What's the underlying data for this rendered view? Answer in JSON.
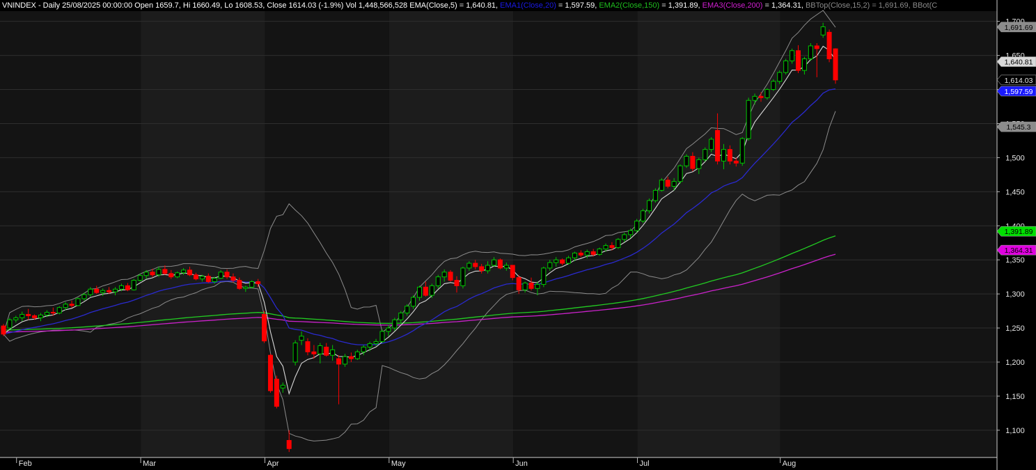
{
  "header": [
    {
      "text": "VNINDEX - Daily 25/08/2025 00:00:00 Open 1659.7, Hi 1660.49, Lo 1608.53, Close 1614.03 (-1.9%) Vol 1,448,566,528 ",
      "color": "#ffffff"
    },
    {
      "text": "EMA(Close,5) = 1,640.81, ",
      "color": "#ffffff"
    },
    {
      "text": "EMA1(Close,20)",
      "color": "#1a1ae6"
    },
    {
      "text": " = 1,597.59, ",
      "color": "#ffffff"
    },
    {
      "text": "EMA2(Close,150)",
      "color": "#1fbf1f"
    },
    {
      "text": " = 1,391.89, ",
      "color": "#ffffff"
    },
    {
      "text": "EMA3(Close,200)",
      "color": "#d01fd0"
    },
    {
      "text": " = 1,364.31, ",
      "color": "#ffffff"
    },
    {
      "text": "BBTop(Close,15,2) = 1,691.69, BBot(C",
      "color": "#8a8a8a"
    }
  ],
  "colors": {
    "up": "#00c800",
    "down": "#ff0000",
    "ema5": "#d8d8d8",
    "ema20": "#2a2ad0",
    "ema150": "#22cc22",
    "ema200": "#cc22cc",
    "bb": "#8c8c8c",
    "grid": "#2a2a2a"
  },
  "chart_data": {
    "type": "candlestick",
    "symbol": "VNINDEX",
    "ylim": [
      1060,
      1715
    ],
    "y_ticks": [
      "1,100",
      "1,150",
      "1,200",
      "1,250",
      "1,300",
      "1,350",
      "1,400",
      "1,450",
      "1,500",
      "1,550",
      "1,600",
      "1,650",
      "1,700"
    ],
    "x_months": [
      {
        "label": "Feb",
        "index": 3
      },
      {
        "label": "Mar",
        "index": 23
      },
      {
        "label": "Apr",
        "index": 43
      },
      {
        "label": "May",
        "index": 63
      },
      {
        "label": "Jun",
        "index": 83
      },
      {
        "label": "Jul",
        "index": 103
      },
      {
        "label": "Aug",
        "index": 126
      }
    ],
    "value_tags": [
      {
        "label": "1,691.69",
        "value": 1691.69,
        "bg": "#8c8c8c",
        "fg": "#000000"
      },
      {
        "label": "1,640.81",
        "value": 1640.81,
        "bg": "#d8d8d8",
        "fg": "#000000"
      },
      {
        "label": "1,614.03",
        "value": 1614.03,
        "bg": "#000000",
        "fg": "#e6e6e6"
      },
      {
        "label": "1,597.59",
        "value": 1597.59,
        "bg": "#1a1aff",
        "fg": "#ffffff"
      },
      {
        "label": "1,545.3",
        "value": 1545.3,
        "bg": "#8c8c8c",
        "fg": "#000000"
      },
      {
        "label": "1,391.89",
        "value": 1391.89,
        "bg": "#00e000",
        "fg": "#000000"
      },
      {
        "label": "1,364.31",
        "value": 1364.31,
        "bg": "#e000e0",
        "fg": "#000000"
      }
    ],
    "ohlc": [
      [
        1253,
        1256,
        1238,
        1241
      ],
      [
        1250,
        1265,
        1248,
        1262
      ],
      [
        1262,
        1268,
        1258,
        1265
      ],
      [
        1265,
        1274,
        1260,
        1270
      ],
      [
        1270,
        1278,
        1262,
        1268
      ],
      [
        1268,
        1270,
        1262,
        1265
      ],
      [
        1265,
        1272,
        1260,
        1269
      ],
      [
        1269,
        1276,
        1266,
        1273
      ],
      [
        1273,
        1280,
        1268,
        1272
      ],
      [
        1272,
        1282,
        1270,
        1280
      ],
      [
        1280,
        1288,
        1276,
        1285
      ],
      [
        1285,
        1290,
        1280,
        1283
      ],
      [
        1283,
        1295,
        1282,
        1293
      ],
      [
        1293,
        1302,
        1290,
        1299
      ],
      [
        1299,
        1310,
        1296,
        1307
      ],
      [
        1307,
        1312,
        1300,
        1302
      ],
      [
        1302,
        1308,
        1297,
        1305
      ],
      [
        1305,
        1310,
        1300,
        1303
      ],
      [
        1303,
        1310,
        1298,
        1307
      ],
      [
        1307,
        1315,
        1304,
        1312
      ],
      [
        1312,
        1316,
        1304,
        1306
      ],
      [
        1306,
        1322,
        1305,
        1320
      ],
      [
        1320,
        1330,
        1318,
        1327
      ],
      [
        1327,
        1335,
        1322,
        1332
      ],
      [
        1332,
        1337,
        1325,
        1328
      ],
      [
        1328,
        1340,
        1325,
        1336
      ],
      [
        1336,
        1342,
        1328,
        1330
      ],
      [
        1330,
        1335,
        1322,
        1325
      ],
      [
        1325,
        1333,
        1323,
        1331
      ],
      [
        1331,
        1338,
        1328,
        1335
      ],
      [
        1335,
        1340,
        1326,
        1328
      ],
      [
        1328,
        1331,
        1320,
        1322
      ],
      [
        1322,
        1328,
        1318,
        1326
      ],
      [
        1326,
        1330,
        1316,
        1318
      ],
      [
        1318,
        1325,
        1315,
        1323
      ],
      [
        1323,
        1335,
        1322,
        1332
      ],
      [
        1332,
        1336,
        1322,
        1325
      ],
      [
        1325,
        1330,
        1317,
        1320
      ],
      [
        1320,
        1324,
        1306,
        1308
      ],
      [
        1308,
        1312,
        1303,
        1310
      ],
      [
        1310,
        1320,
        1308,
        1318
      ],
      [
        1318,
        1322,
        1310,
        1315
      ],
      [
        1270,
        1275,
        1228,
        1231
      ],
      [
        1210,
        1212,
        1155,
        1158
      ],
      [
        1175,
        1180,
        1132,
        1135
      ],
      [
        1162,
        1170,
        1155,
        1166
      ],
      [
        1085,
        1100,
        1068,
        1073
      ],
      [
        1200,
        1232,
        1195,
        1228
      ],
      [
        1232,
        1245,
        1225,
        1238
      ],
      [
        1230,
        1235,
        1210,
        1215
      ],
      [
        1215,
        1225,
        1205,
        1212
      ],
      [
        1212,
        1228,
        1198,
        1224
      ],
      [
        1222,
        1228,
        1208,
        1210
      ],
      [
        1210,
        1225,
        1202,
        1218
      ],
      [
        1205,
        1210,
        1138,
        1197
      ],
      [
        1197,
        1212,
        1193,
        1208
      ],
      [
        1208,
        1214,
        1200,
        1205
      ],
      [
        1205,
        1218,
        1203,
        1215
      ],
      [
        1215,
        1225,
        1210,
        1222
      ],
      [
        1222,
        1230,
        1216,
        1227
      ],
      [
        1227,
        1234,
        1224,
        1230
      ],
      [
        1230,
        1248,
        1228,
        1245
      ],
      [
        1245,
        1255,
        1238,
        1250
      ],
      [
        1250,
        1265,
        1246,
        1262
      ],
      [
        1262,
        1275,
        1258,
        1272
      ],
      [
        1272,
        1285,
        1268,
        1282
      ],
      [
        1282,
        1298,
        1278,
        1295
      ],
      [
        1295,
        1312,
        1290,
        1310
      ],
      [
        1310,
        1318,
        1296,
        1298
      ],
      [
        1298,
        1315,
        1294,
        1312
      ],
      [
        1312,
        1328,
        1308,
        1325
      ],
      [
        1325,
        1336,
        1318,
        1332
      ],
      [
        1332,
        1335,
        1318,
        1320
      ],
      [
        1320,
        1326,
        1302,
        1312
      ],
      [
        1312,
        1340,
        1308,
        1338
      ],
      [
        1338,
        1348,
        1334,
        1345
      ],
      [
        1345,
        1350,
        1336,
        1340
      ],
      [
        1340,
        1344,
        1330,
        1334
      ],
      [
        1334,
        1348,
        1330,
        1342
      ],
      [
        1342,
        1354,
        1340,
        1350
      ],
      [
        1350,
        1352,
        1336,
        1338
      ],
      [
        1338,
        1346,
        1334,
        1342
      ],
      [
        1342,
        1336,
        1320,
        1324
      ],
      [
        1324,
        1328,
        1300,
        1306
      ],
      [
        1306,
        1318,
        1302,
        1316
      ],
      [
        1316,
        1324,
        1305,
        1308
      ],
      [
        1308,
        1318,
        1298,
        1314
      ],
      [
        1314,
        1340,
        1310,
        1338
      ],
      [
        1338,
        1350,
        1334,
        1346
      ],
      [
        1346,
        1354,
        1340,
        1350
      ],
      [
        1350,
        1352,
        1342,
        1345
      ],
      [
        1345,
        1356,
        1343,
        1353
      ],
      [
        1353,
        1362,
        1348,
        1360
      ],
      [
        1360,
        1364,
        1354,
        1357
      ],
      [
        1357,
        1365,
        1352,
        1362
      ],
      [
        1362,
        1366,
        1355,
        1358
      ],
      [
        1358,
        1368,
        1356,
        1366
      ],
      [
        1366,
        1374,
        1362,
        1371
      ],
      [
        1371,
        1376,
        1364,
        1368
      ],
      [
        1368,
        1382,
        1366,
        1380
      ],
      [
        1380,
        1390,
        1376,
        1387
      ],
      [
        1387,
        1396,
        1382,
        1393
      ],
      [
        1393,
        1410,
        1390,
        1407
      ],
      [
        1407,
        1425,
        1404,
        1422
      ],
      [
        1422,
        1440,
        1418,
        1437
      ],
      [
        1437,
        1455,
        1434,
        1452
      ],
      [
        1452,
        1470,
        1450,
        1467
      ],
      [
        1467,
        1472,
        1455,
        1458
      ],
      [
        1458,
        1470,
        1452,
        1465
      ],
      [
        1465,
        1490,
        1462,
        1488
      ],
      [
        1488,
        1505,
        1485,
        1502
      ],
      [
        1502,
        1508,
        1480,
        1484
      ],
      [
        1484,
        1500,
        1476,
        1497
      ],
      [
        1497,
        1515,
        1494,
        1512
      ],
      [
        1512,
        1530,
        1508,
        1527
      ],
      [
        1540,
        1565,
        1490,
        1495
      ],
      [
        1495,
        1520,
        1483,
        1512
      ],
      [
        1512,
        1518,
        1490,
        1495
      ],
      [
        1495,
        1500,
        1487,
        1492
      ],
      [
        1492,
        1530,
        1488,
        1528
      ],
      [
        1528,
        1588,
        1525,
        1584
      ],
      [
        1584,
        1594,
        1578,
        1590
      ],
      [
        1590,
        1596,
        1582,
        1588
      ],
      [
        1588,
        1602,
        1585,
        1600
      ],
      [
        1600,
        1615,
        1598,
        1612
      ],
      [
        1612,
        1628,
        1608,
        1625
      ],
      [
        1625,
        1645,
        1622,
        1642
      ],
      [
        1642,
        1660,
        1638,
        1657
      ],
      [
        1657,
        1665,
        1624,
        1628
      ],
      [
        1628,
        1648,
        1622,
        1645
      ],
      [
        1645,
        1668,
        1642,
        1664
      ],
      [
        1664,
        1668,
        1618,
        1660
      ],
      [
        1680,
        1698,
        1676,
        1692
      ],
      [
        1684,
        1688,
        1640,
        1645
      ],
      [
        1659.7,
        1660.49,
        1608.53,
        1614.03
      ]
    ]
  }
}
